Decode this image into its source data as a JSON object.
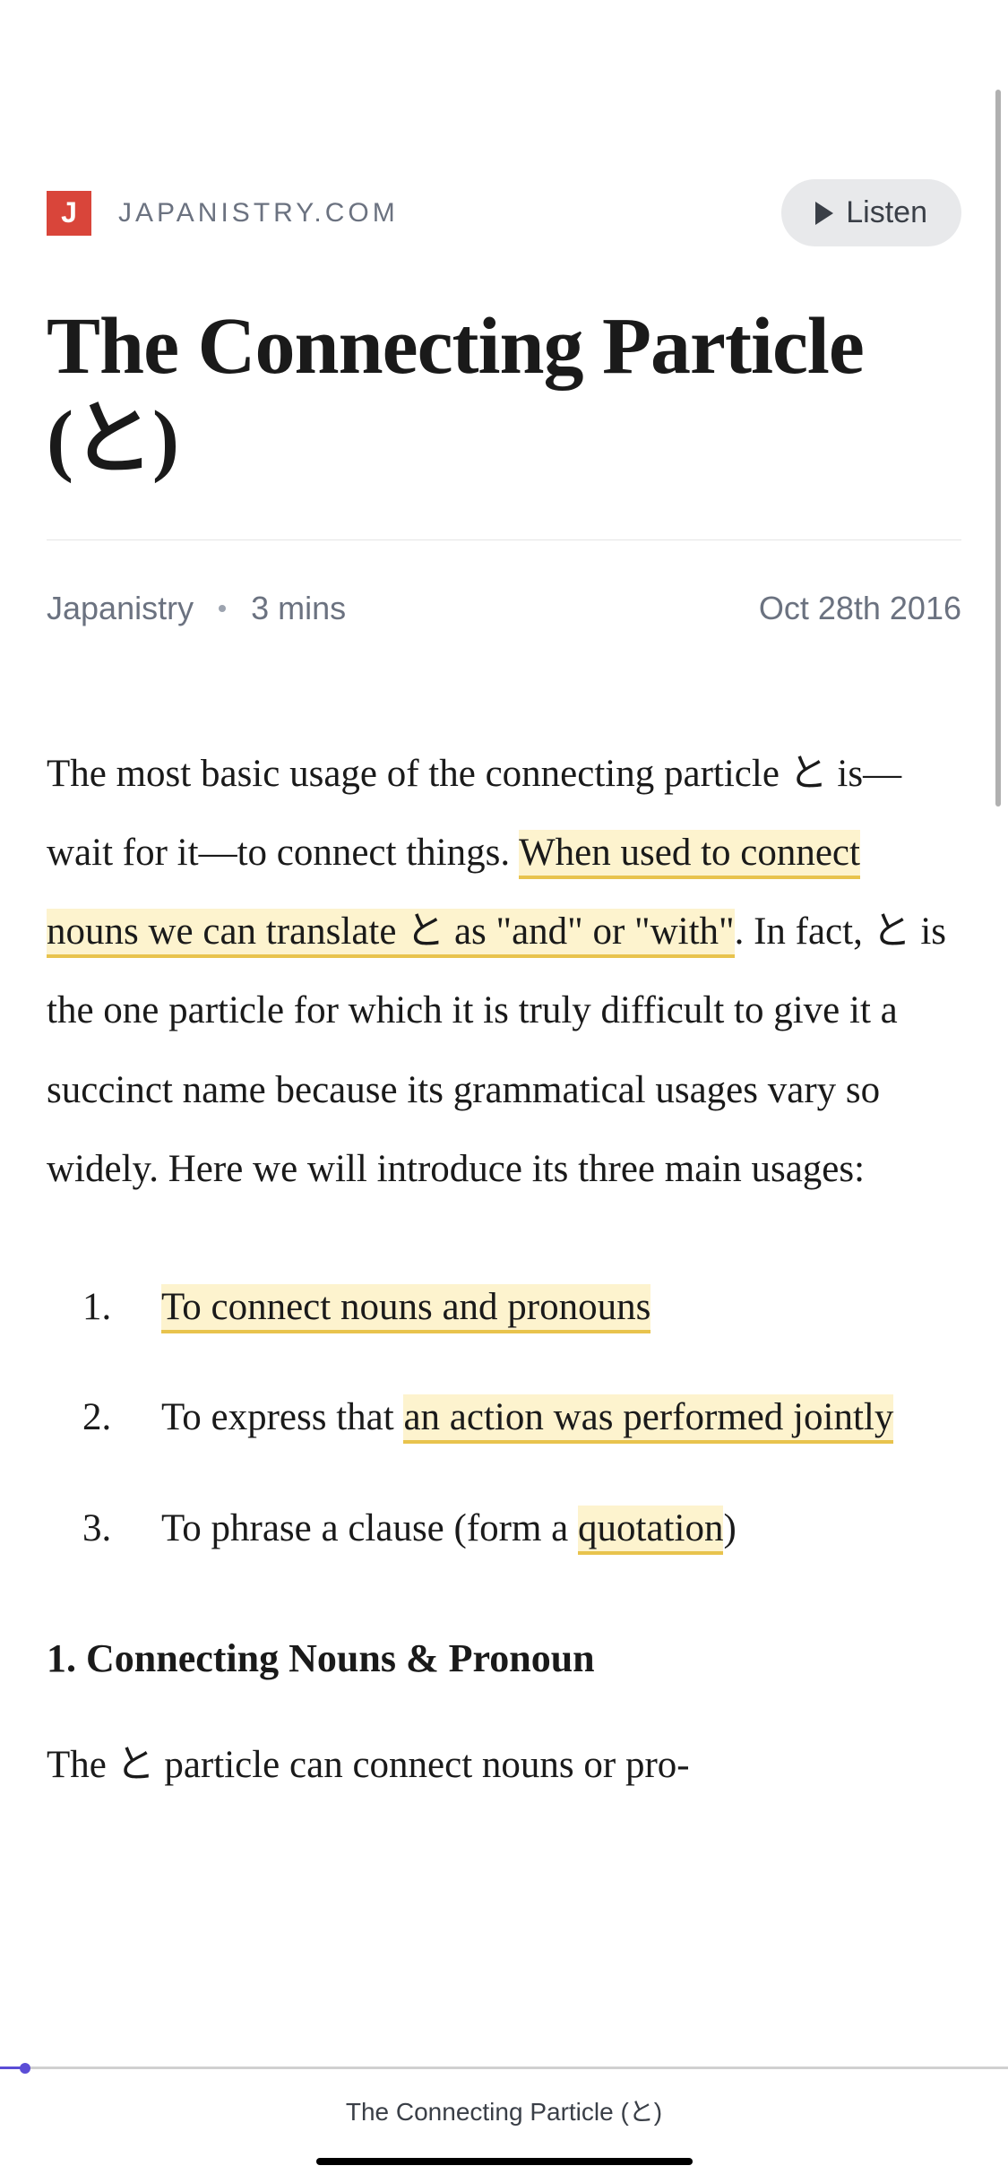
{
  "header": {
    "site_logo_letter": "J",
    "site_name": "JAPANISTRY.COM",
    "listen_label": "Listen"
  },
  "article": {
    "title": "The Connecting Particle (と)",
    "author": "Japanistry",
    "read_time": "3 mins",
    "date": "Oct 28th 2016"
  },
  "body": {
    "p1_a": "The most basic usage of the connecting parti­cle と is—wait for it—to connect things. ",
    "p1_hl1": "When used to connect nouns we can translate と as \"and\" or \"with\"",
    "p1_b": ". In fact, と is the one particle for which it is truly difficult to give it a suc­cinct name because its grammatical usages vary so widely. Here we will introduce its three main usages:",
    "list": {
      "item1_num": "1.",
      "item1_hl": "To connect nouns and pronouns",
      "item2_num": "2.",
      "item2_a": "To express that ",
      "item2_hl": "an action was performed jointly",
      "item3_num": "3.",
      "item3_a": "To phrase a clause (form a ",
      "item3_hl": "quotation",
      "item3_b": ")"
    },
    "heading1": "1. Connecting Nouns & Pronoun",
    "p2_a": "The と particle can connect nouns or pro-"
  },
  "bottom": {
    "title": "The Connecting Particle (と)"
  }
}
